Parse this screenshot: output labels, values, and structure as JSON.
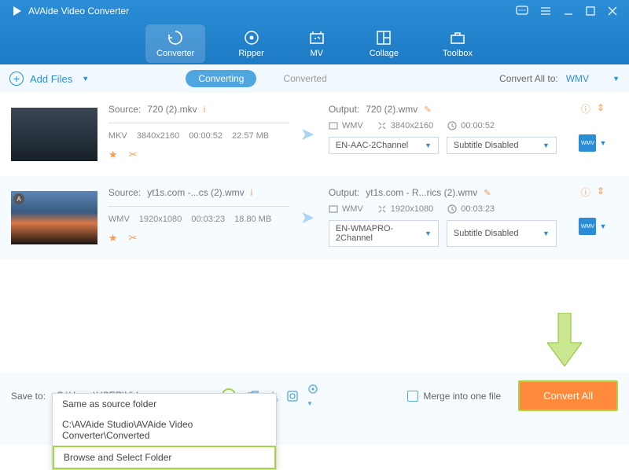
{
  "title": "AVAide Video Converter",
  "tabs": [
    "Converter",
    "Ripper",
    "MV",
    "Collage",
    "Toolbox"
  ],
  "toolbar": {
    "add_files": "Add Files",
    "converting": "Converting",
    "converted": "Converted",
    "convert_all_to": "Convert All to:",
    "format": "WMV"
  },
  "files": [
    {
      "source_label": "Source:",
      "source": "720 (2).mkv",
      "codec": "MKV",
      "res": "3840x2160",
      "dur": "00:00:52",
      "size": "22.57 MB",
      "output_label": "Output:",
      "output": "720 (2).wmv",
      "out_codec": "WMV",
      "out_res": "3840x2160",
      "out_dur": "00:00:52",
      "audio": "EN-AAC-2Channel",
      "subtitle": "Subtitle Disabled"
    },
    {
      "source_label": "Source:",
      "source": "yt1s.com -...cs (2).wmv",
      "codec": "WMV",
      "res": "1920x1080",
      "dur": "00:03:23",
      "size": "18.80 MB",
      "output_label": "Output:",
      "output": "yt1s.com - R...rics (2).wmv",
      "out_codec": "WMV",
      "out_res": "1920x1080",
      "out_dur": "00:03:23",
      "audio": "EN-WMAPRO-2Channel",
      "subtitle": "Subtitle Disabled"
    }
  ],
  "bottom": {
    "save_to": "Save to:",
    "path": "C:\\Users\\USER\\Videos",
    "merge": "Merge into one file",
    "convert_all": "Convert All"
  },
  "dropdown": {
    "same": "Same as source folder",
    "recent": "C:\\AVAide Studio\\AVAide Video Converter\\Converted",
    "browse": "Browse and Select Folder"
  }
}
